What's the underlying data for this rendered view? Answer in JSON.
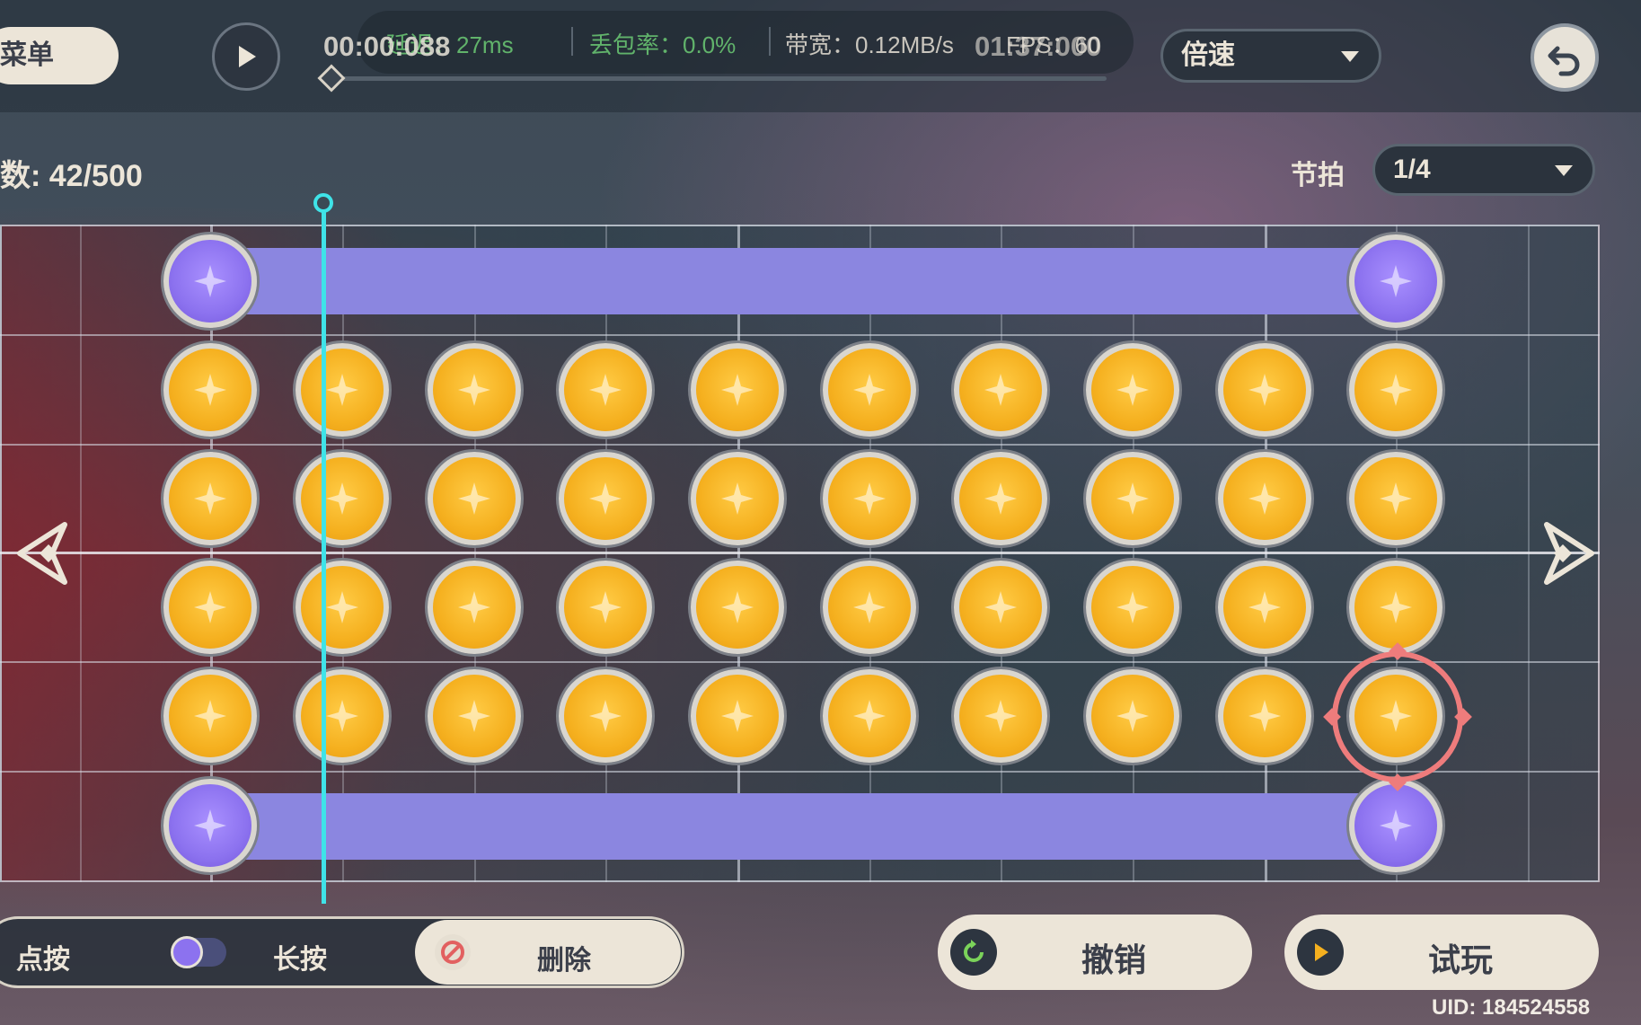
{
  "toolbar": {
    "menu_label": "菜单",
    "current_time": "00:00:088",
    "total_time": "01:37:000",
    "speed_label": "倍速",
    "icons": [
      "play-icon",
      "undo-arrow-icon",
      "chevron-down-icon"
    ]
  },
  "network_overlay": {
    "latency": "延迟：27ms",
    "packet_loss": "丢包率：0.0%",
    "bandwidth": "带宽：0.12MB/s",
    "fps": "FPS：60"
  },
  "editor": {
    "note_count": "数: 42/500",
    "beat_label": "节拍",
    "beat_value": "1/4"
  },
  "tools": {
    "tap_label": "点按",
    "hold_label": "长按",
    "delete_label": "删除",
    "undo_label": "撤销",
    "try_label": "试玩"
  },
  "footer": {
    "uid": "UID: 184524558"
  },
  "colors": {
    "tap_note": "#f5b01f",
    "hold_note": "#8c72ef",
    "playhead": "#3fe3e8",
    "selection": "#ee7c7c",
    "button_bg": "#ece5d8"
  }
}
